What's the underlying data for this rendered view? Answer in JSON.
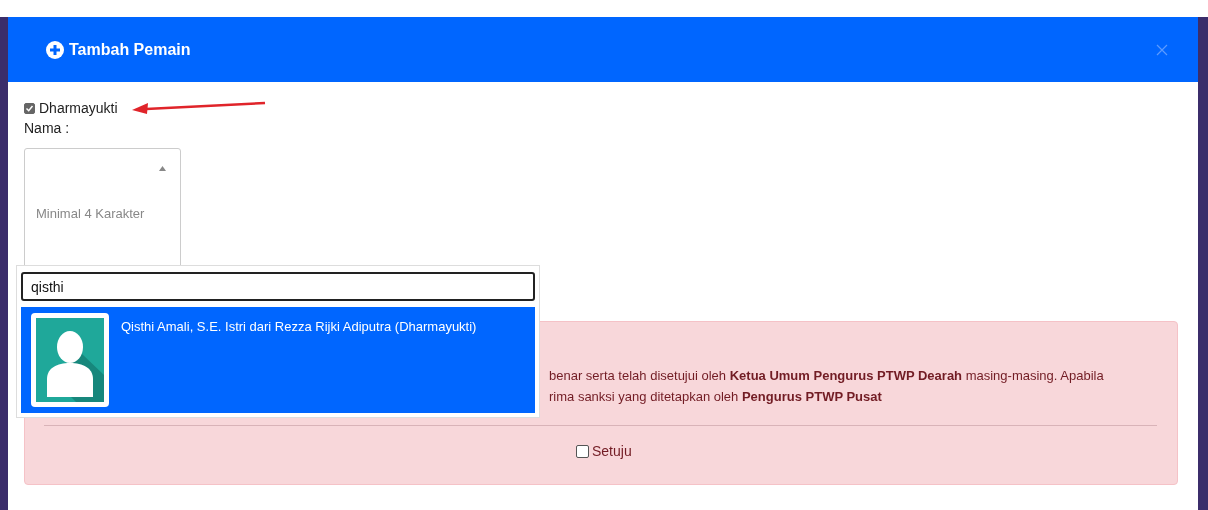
{
  "modal": {
    "title": "Tambah Pemain"
  },
  "dharmayukti": {
    "label": "Dharmayukti",
    "checked": true
  },
  "name_label": "Nama :",
  "select": {
    "placeholder": "Minimal 4 Karakter",
    "expanded": true
  },
  "search": {
    "value": "qisthi"
  },
  "results": [
    {
      "text": "Qisthi Amali, S.E. Istri dari Rezza Rijki Adiputra (Dharmayukti)",
      "selected": true
    }
  ],
  "notice": {
    "lines": [
      "benar serta telah disetujui oleh **Ketua Umum Pengurus PTWP Dearah** masing-masing. Apabila",
      "rima sanksi yang ditetapkan oleh **Pengurus PTWP Pusat**"
    ]
  },
  "agree": {
    "label": "Setuju",
    "checked": false
  }
}
